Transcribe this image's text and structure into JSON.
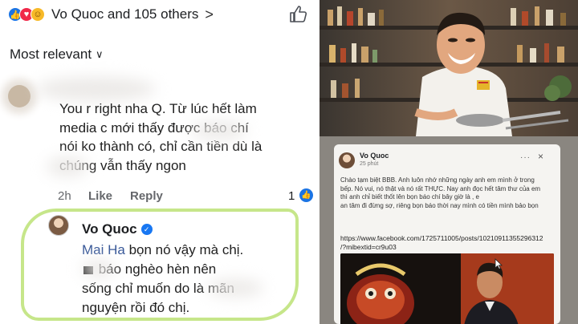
{
  "reactions": {
    "icons": [
      "like-reaction-icon",
      "love-reaction-icon",
      "haha-reaction-icon"
    ],
    "summary": "Vo Quoc and 105 others",
    "chevron": ">"
  },
  "sort": {
    "label": "Most relevant",
    "chevron": "∨"
  },
  "comment1": {
    "lines": [
      "You r right nha Q. Từ lúc hết làm",
      "media c mới thấy được        báo chí",
      "nói ko thành có, chỉ cần tiền dù là",
      "         chúng vẫn thấy ngon"
    ],
    "time": "2h",
    "like_label": "Like",
    "reply_label": "Reply",
    "like_count": "1"
  },
  "comment2": {
    "author": "Vo Quoc",
    "mention": "Mai Ha",
    "line1_rest": " bọn nó vậy mà chị.",
    "line2_rest": " báo nghèo hèn nên",
    "line3": "sống chỉ muốn do          là mãn",
    "line4": "nguyện rồi đó chị."
  },
  "post": {
    "author": "Vo Quoc",
    "time": "25 phút",
    "more": "···",
    "close": "×",
    "body_lines": [
      "Chào tạm biệt BBB. Anh luôn nhớ những ngày anh em mình ở trong",
      "bếp. Nó vui, nó thật và nó rất THỰC. Nay anh đọc hết tâm thư của em",
      "thì anh chỉ biết thốt lên bọn báo chí bây giờ là                         , e",
      "an tâm đi đừng sợ, riêng bọn báo thời nay mình có tiền mình bảo bọn"
    ],
    "link_lines": [
      "https://www.facebook.com/1725711005/posts/10210911355296312",
      "/?mibextid=cr9u03"
    ]
  },
  "colors": {
    "fb_blue": "#1b74e4",
    "verified": "#1877f2",
    "highlight": "#c6e68a",
    "meta_gray": "#65676b",
    "mention": "#385898"
  }
}
